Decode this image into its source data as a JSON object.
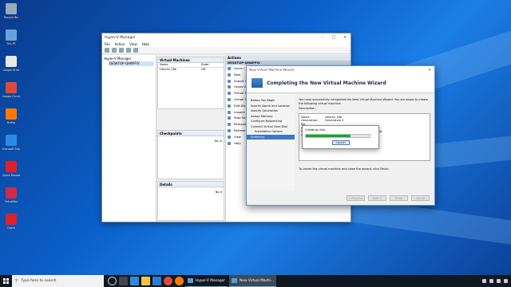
{
  "desktop": {
    "icons": [
      {
        "label": "Recycle Bin",
        "color": "#9ab"
      },
      {
        "label": "This PC",
        "color": "#6aa3d8"
      },
      {
        "label": "Google Drive",
        "color": "#e8e8e8"
      },
      {
        "label": "Google Chrome",
        "color": "#e04a3a"
      },
      {
        "label": "Firefox",
        "color": "#ff7a00"
      },
      {
        "label": "Microsoft Edge",
        "color": "#2a8ce0"
      },
      {
        "label": "Opera Browser",
        "color": "#e0202a"
      },
      {
        "label": "VirtualBox",
        "color": "#d02a4a"
      },
      {
        "label": "Opera",
        "color": "#e0202a"
      }
    ]
  },
  "hyperv": {
    "title": "Hyper-V Manager",
    "menu": [
      "File",
      "Action",
      "View",
      "Help"
    ],
    "tree": {
      "root": "Hyper-V Manager",
      "host": "DESKTOP-QHNPFIV"
    },
    "vms_pane": {
      "title": "Virtual Machines",
      "col_name": "Name",
      "col_state": "State",
      "rows": [
        {
          "name": "Ubuntu 18b",
          "state": "Off"
        }
      ]
    },
    "checkpoints_pane": {
      "title": "Checkpoints",
      "empty": "No vi"
    },
    "details_pane": {
      "title": "Details",
      "empty": "No it"
    },
    "actions": {
      "title": "Actions",
      "host": "DESKTOP-QHNPFIV",
      "items": [
        "Quick C",
        "New",
        "Import V",
        "Hyper-V",
        "Virtual S",
        "Virtual S",
        "Edit Dis",
        "Inspect D",
        "Stop Ser",
        "Remove",
        "Refresh",
        "View",
        "Help"
      ]
    }
  },
  "wizard": {
    "title": "New Virtual Machine Wizard",
    "heading": "Completing the New Virtual Machine Wizard",
    "steps": [
      "Before You Begin",
      "Specify Name and Location",
      "Specify Generation",
      "Assign Memory",
      "Configure Networking",
      "Connect Virtual Hard Disk",
      "Installation Options",
      "Summary"
    ],
    "current_step": "Summary",
    "intro": "You have successfully completed the New Virtual Machine Wizard. You are about to create the following virtual machine.",
    "description_label": "Description:",
    "description": [
      {
        "k": "Name:",
        "v": "Ubuntu 18b"
      },
      {
        "k": "Generation:",
        "v": "Generation 2"
      },
      {
        "k": "Me",
        "v": ""
      },
      {
        "k": "Ne",
        "v": ""
      },
      {
        "k": "Ha",
        "v": "ual Hard Disks\\Ubuntu 18b.vhdx (VHDX,"
      },
      {
        "k": "Op",
        "v": "nloads\\ubuntu-18.04.3-desktop-amd6"
      }
    ],
    "finish_note": "To create the virtual machine and close the wizard, click Finish.",
    "buttons": [
      "< Previous",
      "Next >",
      "Finish",
      "Cancel"
    ]
  },
  "progress_dialog": {
    "title": "Creating disk...",
    "progress_percent": 70,
    "cancel_label": "Cancel"
  },
  "taskbar": {
    "search_placeholder": "Type here to search",
    "apps": [
      {
        "label": "Hyper-V Manager",
        "active": false
      },
      {
        "label": "New Virtual Machi...",
        "active": true
      }
    ]
  }
}
